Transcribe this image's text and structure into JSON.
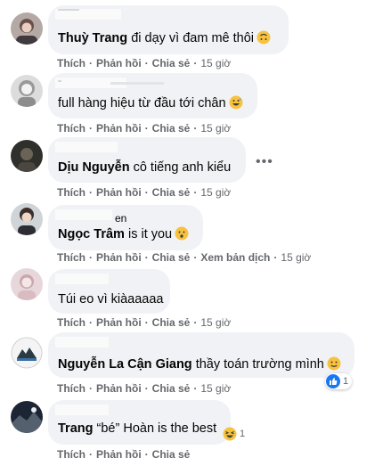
{
  "comments": [
    {
      "name": "Thuỳ Trang",
      "text": "đi dạy vì đam mê thôi",
      "emoji": "upside-down-face-emoji",
      "time": "15 giờ"
    },
    {
      "name_partial": "",
      "text": "full hàng hiệu từ đầu tới chân",
      "emoji": "grinning-sweat-emoji",
      "time": "15 giờ"
    },
    {
      "name": "Dịu Nguyễn",
      "text": "cô tiếng anh kiểu",
      "time": "15 giờ",
      "more_label": "•••"
    },
    {
      "name_partial": "en",
      "name": "Ngọc Trâm",
      "text": "is it you",
      "emoji": "hushed-face-emoji",
      "time": "15 giờ",
      "translate_label": "Xem bản dịch"
    },
    {
      "text": "Túi eo vì kiàaaaaa",
      "time": "15 giờ"
    },
    {
      "name": "Nguyễn La Cận Giang",
      "text": "thầy toán trường mình",
      "emoji": "slightly-smiling-face-emoji",
      "time": "15 giờ",
      "reaction_icon": "like-icon",
      "reaction_count": "1"
    },
    {
      "name": "Trang",
      "nickname": "“bé”",
      "text": "Hoàn is the best",
      "reaction_icon": "laughing-face-icon",
      "reaction_count": "1"
    }
  ],
  "actions": {
    "like": "Thích",
    "reply": "Phản hồi",
    "share": "Chia sẻ",
    "separator": "·"
  },
  "colors": {
    "bubble": "#f0f2f5",
    "meta_text": "#65676b",
    "like_blue": "#1877f2",
    "emoji_yellow": "#f7c23e"
  }
}
